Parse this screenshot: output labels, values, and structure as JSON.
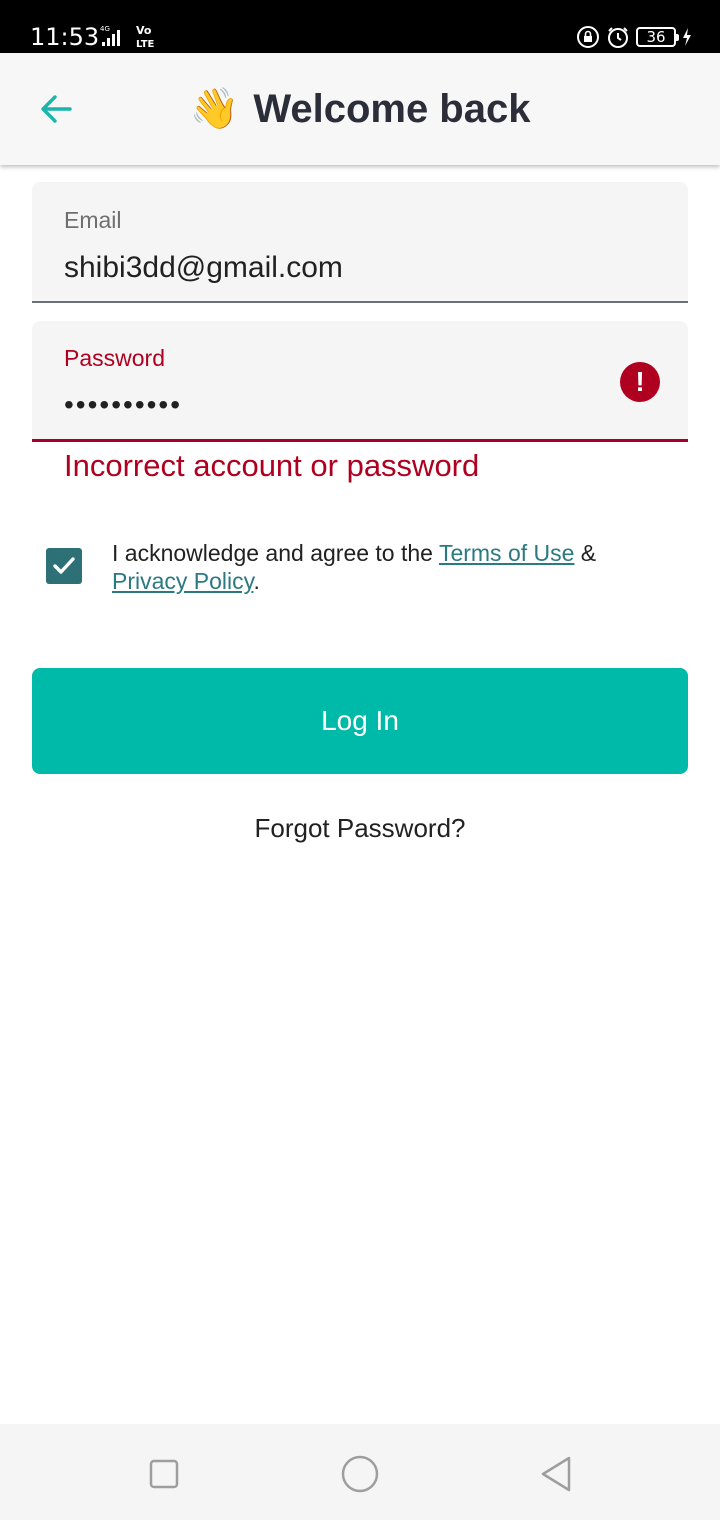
{
  "status_bar": {
    "time": "11:53",
    "network": "4G",
    "volte": "Vo LTE",
    "battery_level": "36",
    "icons": [
      "signal-icon",
      "lock-icon",
      "alarm-icon",
      "battery-icon",
      "charging-icon"
    ]
  },
  "app_bar": {
    "back_icon": "arrow-left-icon",
    "emoji": "👋",
    "title": "Welcome back"
  },
  "email": {
    "label": "Email",
    "value": "shibi3dd@gmail.com"
  },
  "password": {
    "label": "Password",
    "value": "••••••••••",
    "error_icon": "!",
    "error_message": "Incorrect account or password"
  },
  "consent": {
    "checked": true,
    "text_before": "I acknowledge and agree to the ",
    "terms_link": "Terms of Use",
    "text_between": " & ",
    "privacy_link": "Privacy Policy",
    "text_after": "."
  },
  "actions": {
    "login_label": "Log In",
    "forgot_label": "Forgot Password?"
  },
  "nav_bar": {
    "icons": [
      "recents-square-icon",
      "home-circle-icon",
      "back-triangle-icon"
    ]
  },
  "colors": {
    "accent": "#00baa9",
    "error": "#b00020",
    "checkbox": "#2d7076",
    "link": "#2a7a80"
  }
}
